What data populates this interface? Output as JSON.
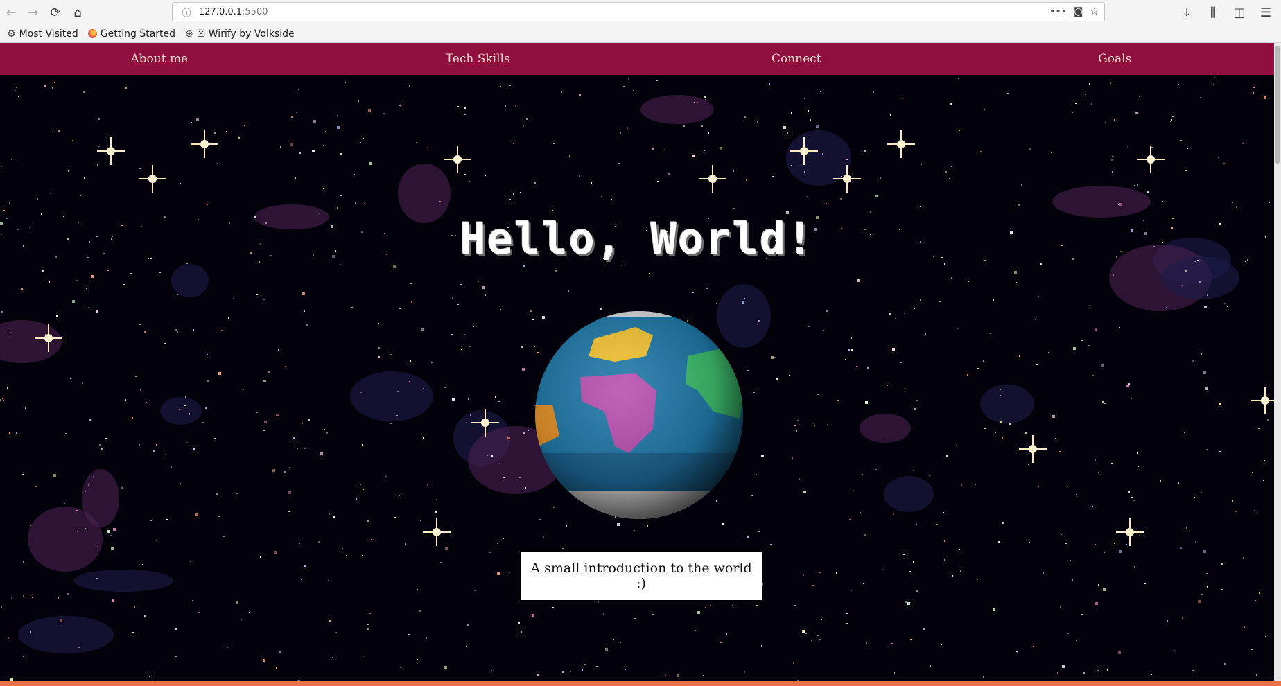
{
  "browser": {
    "url_host": "127.0.0.1",
    "url_port": ":5500",
    "bookmarks": [
      {
        "label": "Most Visited",
        "icon": "gear-icon"
      },
      {
        "label": "Getting Started",
        "icon": "firefox-icon"
      },
      {
        "label": "☒ Wirify by Volkside",
        "icon": "globe-icon"
      }
    ]
  },
  "site": {
    "nav": [
      "About me",
      "Tech Skills",
      "Connect",
      "Goals"
    ],
    "title": "Hello, World!",
    "intro": "A small introduction to the world :)"
  },
  "colors": {
    "nav_bg": "#8f0f3f",
    "nav_text": "#f0d9c8",
    "space_bg": "#03020a",
    "ocean": "#1e78a8",
    "land_europe": "#f4c431",
    "land_africa": "#b84fb0",
    "land_asia": "#3dbf6d",
    "land_americas": "#e8942a"
  }
}
